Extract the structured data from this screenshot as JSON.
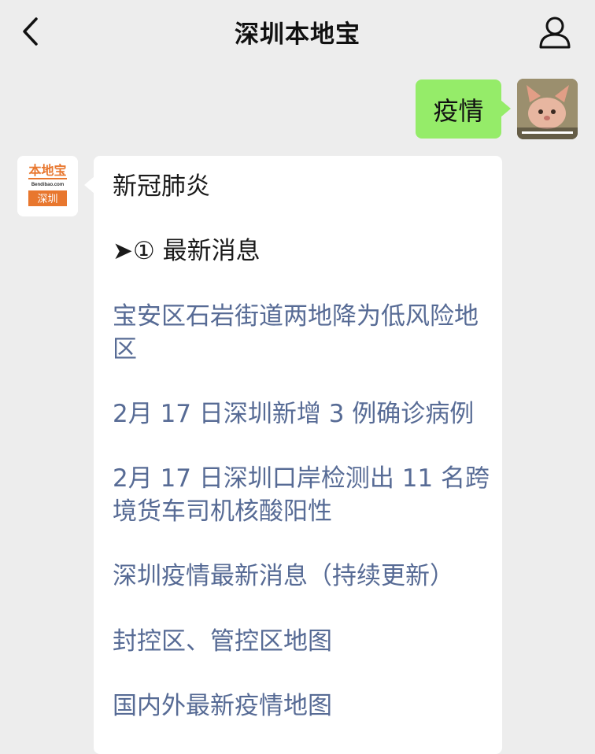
{
  "header": {
    "title": "深圳本地宝"
  },
  "user_message": {
    "text": "疫情"
  },
  "bot": {
    "logo": {
      "top_text": "本地宝",
      "sub_text": "Bendibao.com",
      "city": "深圳"
    },
    "heading": "新冠肺炎",
    "section": "➤① 最新消息",
    "links": [
      "宝安区石岩街道两地降为低风险地区",
      "2月 17 日深圳新增 3 例确诊病例",
      "2月 17 日深圳口岸检测出 11 名跨境货车司机核酸阳性",
      "深圳疫情最新消息（持续更新）",
      "封控区、管控区地图",
      "国内外最新疫情地图"
    ]
  },
  "colors": {
    "background": "#ededed",
    "user_bubble": "#95ec69",
    "link": "#576b95",
    "logo_orange": "#e8772e"
  },
  "icons": [
    "back-chevron-icon",
    "profile-icon"
  ]
}
